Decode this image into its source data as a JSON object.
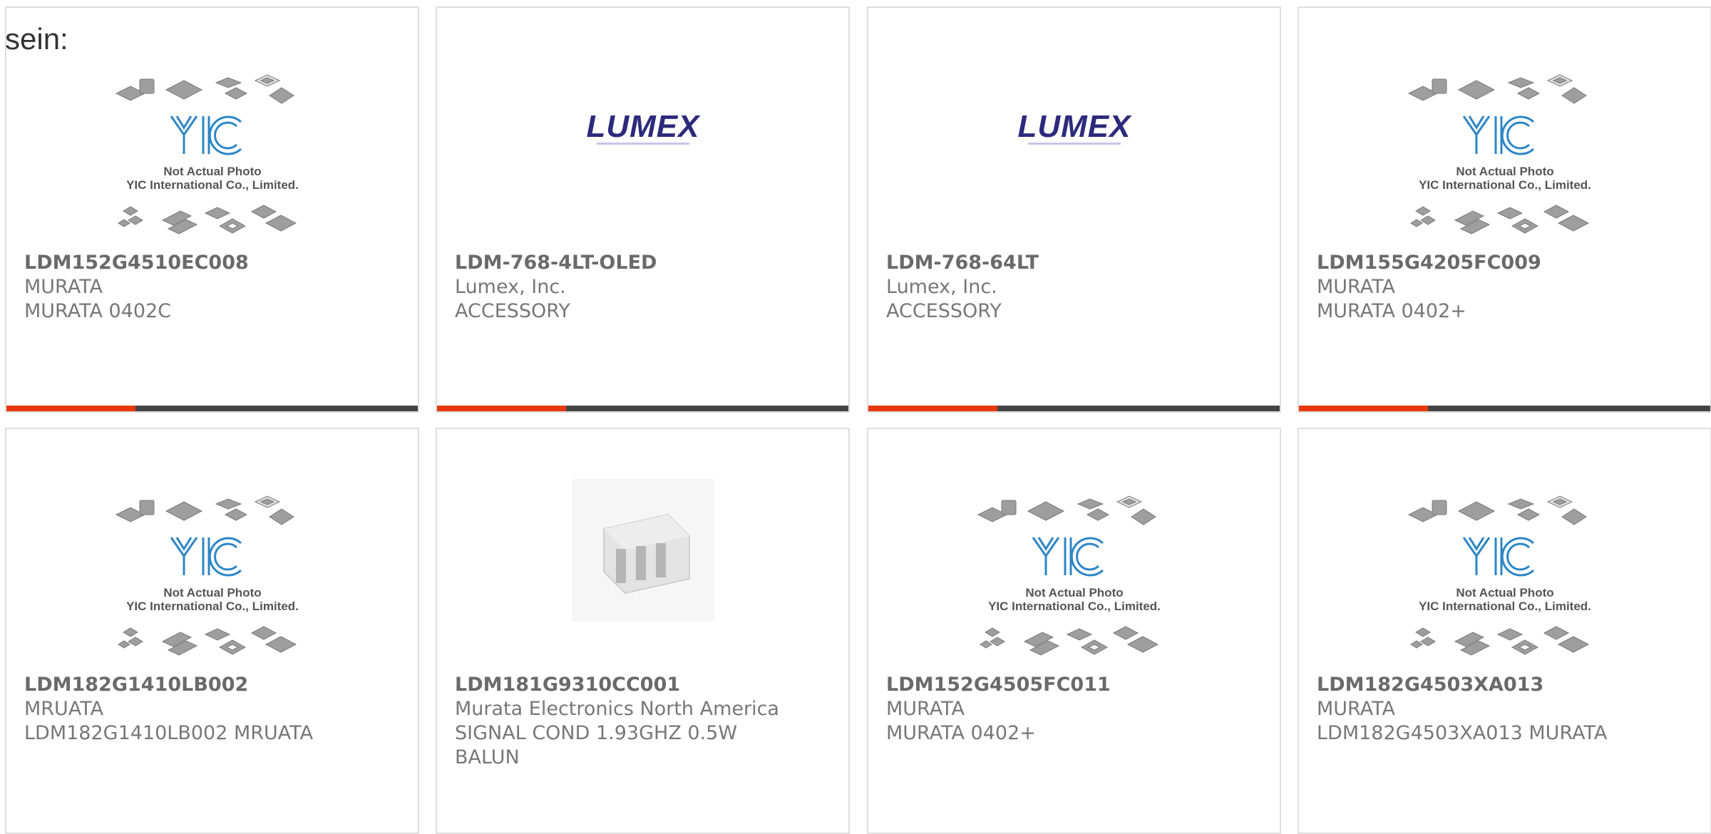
{
  "prefix_text": "sein:",
  "placeholder": {
    "line1": "Not Actual Photo",
    "line2": "YIC International Co., Limited."
  },
  "brand_colors": {
    "accent": "#e8380d",
    "bar": "#444444",
    "yic_blue": "#2c86c7",
    "lumex": "#2d2a7c"
  },
  "products": [
    {
      "part": "LDM152G4510EC008",
      "maker": "MURATA",
      "desc": [
        "MURATA 0402C"
      ],
      "image": "yic-placeholder"
    },
    {
      "part": "LDM-768-4LT-OLED",
      "maker": "Lumex, Inc.",
      "desc": [
        "ACCESSORY"
      ],
      "image": "lumex-logo"
    },
    {
      "part": "LDM-768-64LT",
      "maker": "Lumex, Inc.",
      "desc": [
        "ACCESSORY"
      ],
      "image": "lumex-logo"
    },
    {
      "part": "LDM155G4205FC009",
      "maker": "MURATA",
      "desc": [
        "MURATA 0402+"
      ],
      "image": "yic-placeholder"
    },
    {
      "part": "LDM182G1410LB002",
      "maker": "MRUATA",
      "desc": [
        "LDM182G1410LB002 MRUATA"
      ],
      "image": "yic-placeholder"
    },
    {
      "part": "LDM181G9310CC001",
      "maker": "Murata Electronics North America",
      "desc": [
        "SIGNAL COND 1.93GHZ 0.5W",
        "BALUN"
      ],
      "image": "component-photo"
    },
    {
      "part": "LDM152G4505FC011",
      "maker": "MURATA",
      "desc": [
        "MURATA 0402+"
      ],
      "image": "yic-placeholder"
    },
    {
      "part": "LDM182G4503XA013",
      "maker": "MURATA",
      "desc": [
        "LDM182G4503XA013 MURATA"
      ],
      "image": "yic-placeholder"
    }
  ]
}
